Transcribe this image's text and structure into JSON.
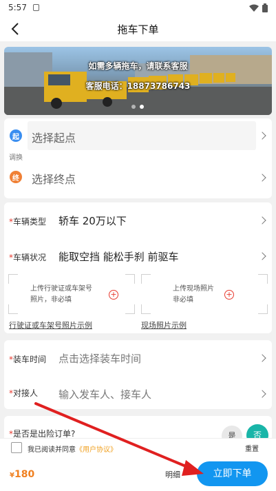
{
  "status_bar": {
    "time": "5:57"
  },
  "header": {
    "title": "拖车下单"
  },
  "banner": {
    "line1": "如需多辆拖车，请联系客服",
    "line2": "客服电话：18873786743"
  },
  "location": {
    "start_icon": "起",
    "start_placeholder": "选择起点",
    "swap_label": "调换",
    "end_icon": "终",
    "end_placeholder": "选择终点"
  },
  "vehicle": {
    "type_label": "车辆类型",
    "type_value": "轿车 20万以下",
    "status_label": "车辆状况",
    "status_value": "能取空挡 能松手刹 前驱车",
    "upload_license_line1": "上传行驶证或车架号",
    "upload_license_line2": "照片，非必填",
    "upload_scene_line1": "上传现场照片",
    "upload_scene_line2": "非必填",
    "license_sample_link": "行驶证或车架号照片示例",
    "scene_sample_link": "现场照片示例"
  },
  "schedule": {
    "time_label": "装车时间",
    "time_placeholder": "点击选择装车时间",
    "contact_label": "对接人",
    "contact_placeholder": "输入发车人、接车人"
  },
  "insurance": {
    "label": "是否是出险订单?",
    "yes": "是",
    "no": "否"
  },
  "agreement": {
    "text": "我已阅读并同意",
    "link": "《用户协议》",
    "reset": "重置"
  },
  "footer": {
    "currency": "¥",
    "price": "180",
    "detail": "明细",
    "submit": "立即下单"
  },
  "colors": {
    "primary": "#1296f0",
    "accent_orange": "#f08020",
    "teal": "#19b5a8",
    "required_red": "#e8392e",
    "annotation_arrow": "#e02020"
  }
}
